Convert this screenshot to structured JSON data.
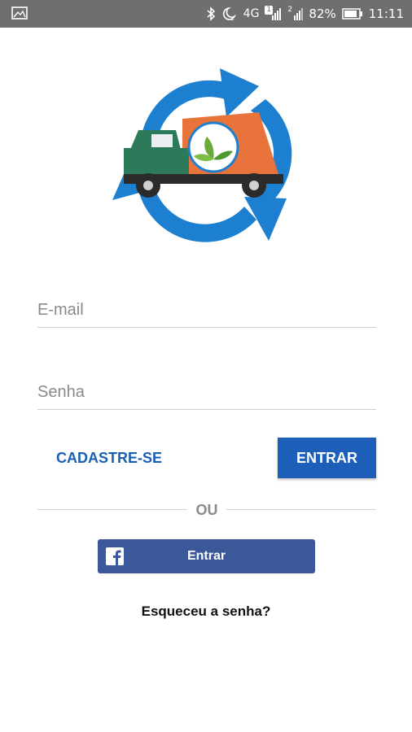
{
  "status_bar": {
    "network": "4G",
    "sim_badge": "1",
    "sim2_badge": "2",
    "battery": "82%",
    "time": "11:11"
  },
  "login": {
    "email_placeholder": "E-mail",
    "password_placeholder": "Senha",
    "register_label": "CADASTRE-SE",
    "submit_label": "ENTRAR",
    "divider_label": "OU",
    "facebook_label": "Entrar",
    "forgot_label": "Esqueceu a senha?"
  },
  "colors": {
    "primary": "#1d5fb8",
    "facebook": "#3b5998",
    "status_bar": "#6f6f6f",
    "logo_blue": "#1c7fcf",
    "truck_orange": "#e8743b",
    "truck_green": "#2d7a5b"
  }
}
